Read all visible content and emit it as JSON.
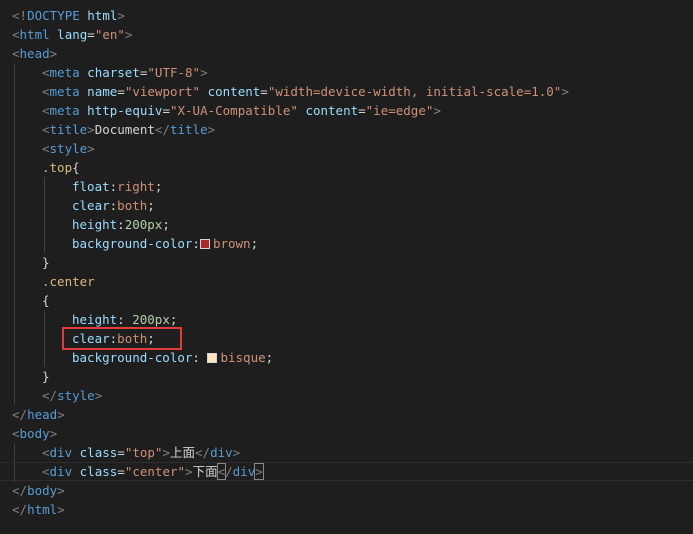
{
  "colors": {
    "background": "#1e1e1e",
    "tag": "#569cd6",
    "attribute": "#9cdcfe",
    "string": "#ce9178",
    "selector": "#d7ba7d",
    "number": "#b5cea8",
    "punctuation": "#808080",
    "text": "#d4d4d4",
    "highlight_box": "#e03c3c",
    "swatch_brown": "#a52a2a",
    "swatch_bisque": "#ffe4c4"
  },
  "code": {
    "l1": {
      "doctype": "DOCTYPE",
      "tag": "html"
    },
    "l2": {
      "tag": "html",
      "attr": "lang",
      "value": "\"en\""
    },
    "l3": {
      "tag": "head"
    },
    "l4": {
      "tag": "meta",
      "attr": "charset",
      "value": "\"UTF-8\""
    },
    "l5": {
      "tag": "meta",
      "attr1": "name",
      "value1": "\"viewport\"",
      "attr2": "content",
      "value2": "\"width=device-width, initial-scale=1.0\""
    },
    "l6": {
      "tag": "meta",
      "attr1": "http-equiv",
      "value1": "\"X-UA-Compatible\"",
      "attr2": "content",
      "value2": "\"ie=edge\""
    },
    "l7": {
      "tag": "title",
      "text": "Document"
    },
    "l8": {
      "tag": "style"
    },
    "l9": {
      "selector": ".top",
      "brace": "{"
    },
    "l10": {
      "prop": "float",
      "value": "right"
    },
    "l11": {
      "prop": "clear",
      "value": "both"
    },
    "l12": {
      "prop": "height",
      "value": "200px"
    },
    "l13": {
      "prop": "background-color",
      "value": "brown"
    },
    "l14": {
      "brace": "}"
    },
    "l15": {
      "selector": ".center"
    },
    "l16": {
      "brace": "{"
    },
    "l17": {
      "prop": "height",
      "value": "200px"
    },
    "l18": {
      "prop": "clear",
      "value": "both"
    },
    "l19": {
      "prop": "background-color",
      "value": "bisque"
    },
    "l20": {
      "brace": "}"
    },
    "l21": {
      "tag": "style"
    },
    "l22": {
      "tag": "head"
    },
    "l23": {
      "tag": "body"
    },
    "l24": {
      "tag": "div",
      "attr": "class",
      "value": "\"top\"",
      "text": "上面"
    },
    "l25": {
      "tag": "div",
      "attr": "class",
      "value": "\"center\"",
      "text": "下面"
    },
    "l26": {
      "tag": "body"
    },
    "l27": {
      "tag": "html"
    }
  }
}
